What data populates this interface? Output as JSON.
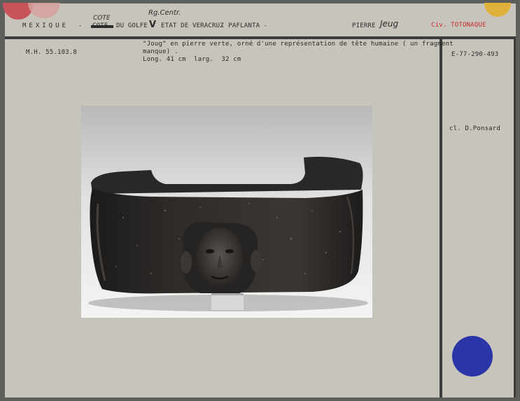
{
  "header": {
    "country": "MEXIQUE",
    "sep1": "-",
    "cote_struck": "COTE",
    "cote_handwritten": "COTE",
    "golfe": "DU GOLFE",
    "mark": "V",
    "etat": "ETAT DE VERACRUZ",
    "sep2": "- PAFLANTA -",
    "region_handwritten": "Rg.Centr.",
    "material_label": "PIERRE",
    "material_handwritten": "Jeug",
    "civ": "Civ. TOTONAQUE"
  },
  "inventory": "M.H. 55.103.8",
  "description": {
    "line1": "\"Joug\" en pierre verte, orné d'une représentation de tête humaine ( un fragment",
    "line2": "manque) .",
    "line3": "Long. 41 cm  larg.  32 cm"
  },
  "side": {
    "number": "E-77-290-493",
    "credit": "cl. D.Ponsard"
  },
  "colors": {
    "card": "#c7c4bb",
    "frame": "#3b3b38",
    "red_dot": "#c9535a",
    "yellow_dot": "#e0b13a",
    "blue_dot": "#2a35a8",
    "civ_red": "#c8262c"
  }
}
